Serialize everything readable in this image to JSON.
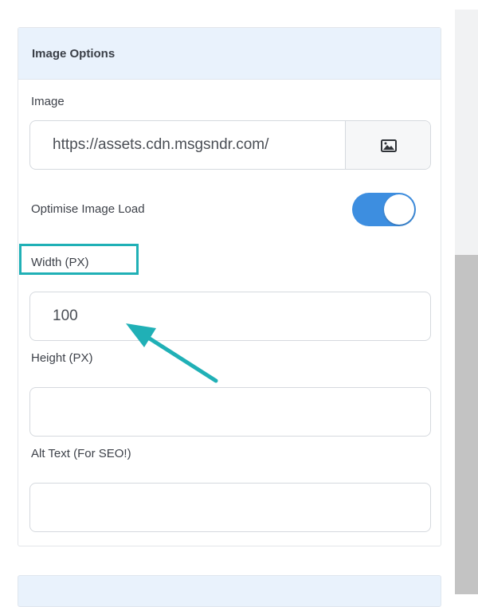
{
  "panel": {
    "title": "Image Options",
    "image_label": "Image",
    "image_url": "https://assets.cdn.msgsndr.com/",
    "image_picker_icon": "image-icon",
    "optimise_label": "Optimise Image Load",
    "optimise_enabled": true,
    "width_label": "Width (PX)",
    "width_value": "100",
    "height_label": "Height (PX)",
    "height_value": "",
    "alt_label": "Alt Text (For SEO!)",
    "alt_value": ""
  },
  "next_panel": {
    "title": ""
  },
  "colors": {
    "header_bg": "#e9f2fc",
    "toggle_on": "#3d8ee0",
    "annotation": "#20b0b6",
    "scrollbar_thumb": "#c3c3c3"
  }
}
